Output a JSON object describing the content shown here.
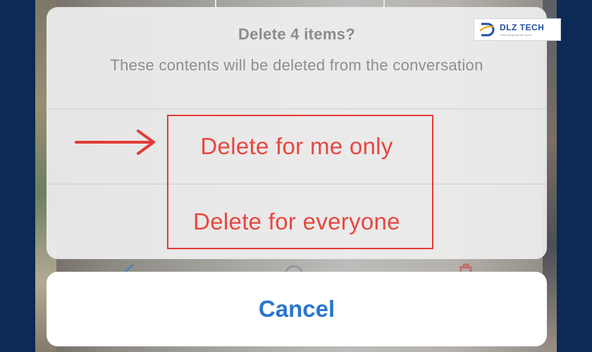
{
  "dialog": {
    "title": "Delete 4 items?",
    "message": "These contents will be deleted from the conversation",
    "actions": [
      {
        "label": "Delete for me only"
      },
      {
        "label": "Delete for everyone"
      }
    ],
    "cancel_label": "Cancel"
  },
  "watermark": {
    "name": "DLZ TECH",
    "slogan": "Chất lượng tạo nên uy tín"
  },
  "toolbar": {
    "icons": [
      "share-icon",
      "compass-icon",
      "trash-icon"
    ]
  },
  "colors": {
    "destructive": "#e8473f",
    "cancel": "#2a77cc",
    "annotation": "#e23b35",
    "frame": "#0b2a55"
  }
}
